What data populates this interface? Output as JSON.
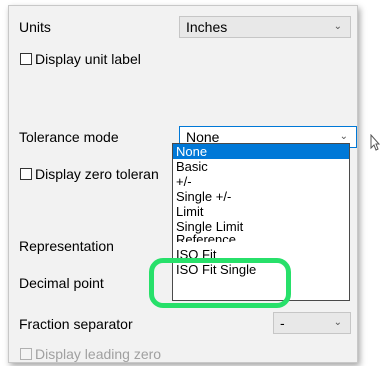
{
  "units": {
    "label": "Units",
    "value": "Inches",
    "display_unit_label": "Display unit label"
  },
  "tolerance": {
    "label": "Tolerance mode",
    "value": "None",
    "display_zero": "Display zero toleran",
    "options": [
      "None",
      "Basic",
      "+/-",
      "Single +/-",
      "Limit",
      "Single Limit",
      "Reference",
      "ISO Fit",
      "ISO Fit Single"
    ]
  },
  "representation": {
    "label": "Representation"
  },
  "decimal_point": {
    "label": "Decimal point"
  },
  "fraction_separator": {
    "label": "Fraction separator",
    "value": "-"
  },
  "leading_zero": {
    "label": "Display leading zero"
  },
  "colors": {
    "highlight": "#27e06a",
    "selection": "#0078d7"
  }
}
